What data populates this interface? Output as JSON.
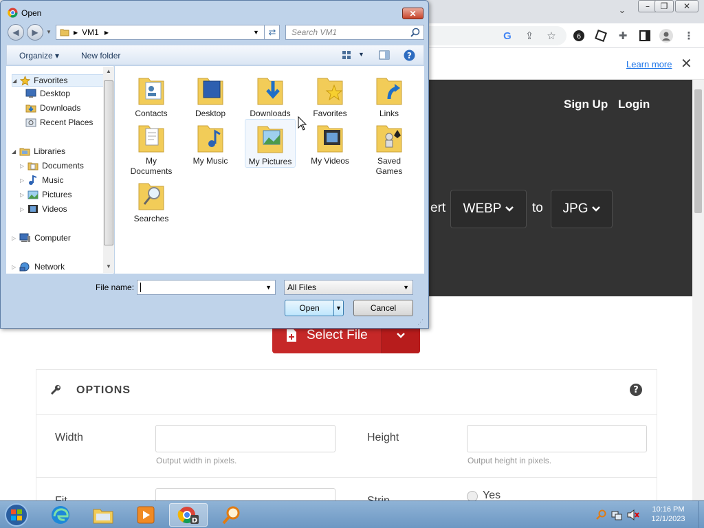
{
  "browser": {
    "infobar": {
      "learn_more": "Learn more",
      "close": "✕"
    },
    "nav": {
      "signup": "Sign Up",
      "login": "Login"
    },
    "converter": {
      "convert_word": "ert",
      "from_format": "WEBP",
      "to_word": "to",
      "to_format": "JPG",
      "caret": "⌄"
    },
    "select_file": {
      "label": "Select File"
    },
    "options": {
      "title": "OPTIONS",
      "width_label": "Width",
      "width_help": "Output width in pixels.",
      "height_label": "Height",
      "height_help": "Output height in pixels.",
      "fit_label": "Fit",
      "strip_label": "Strip",
      "strip_yes": "Yes"
    }
  },
  "dialog": {
    "title": "Open",
    "address": {
      "segment": "VM1"
    },
    "search_placeholder": "Search VM1",
    "toolbar": {
      "organize": "Organize ▾",
      "new_folder": "New folder"
    },
    "nav_pane": {
      "favorites": "Favorites",
      "desktop": "Desktop",
      "downloads": "Downloads",
      "recent_places": "Recent Places",
      "libraries": "Libraries",
      "documents": "Documents",
      "music": "Music",
      "pictures": "Pictures",
      "videos": "Videos",
      "computer": "Computer",
      "network": "Network"
    },
    "folders": {
      "contacts": "Contacts",
      "desktop": "Desktop",
      "downloads": "Downloads",
      "favorites": "Favorites",
      "links": "Links",
      "my_documents": "My Documents",
      "my_music": "My Music",
      "my_pictures": "My Pictures",
      "my_videos": "My Videos",
      "saved_games": "Saved Games",
      "searches": "Searches"
    },
    "file_name_label": "File name:",
    "file_name_value": "",
    "file_type": "All Files",
    "open_button": "Open",
    "cancel_button": "Cancel"
  },
  "taskbar": {
    "time": "10:16 PM",
    "date": "12/1/2023"
  },
  "colors": {
    "hero_bg": "#333333",
    "select_btn": "#c62828",
    "link_blue": "#1a73e8",
    "taskbar": "#7ba2cb",
    "folder_yellow": "#f2cc58"
  }
}
